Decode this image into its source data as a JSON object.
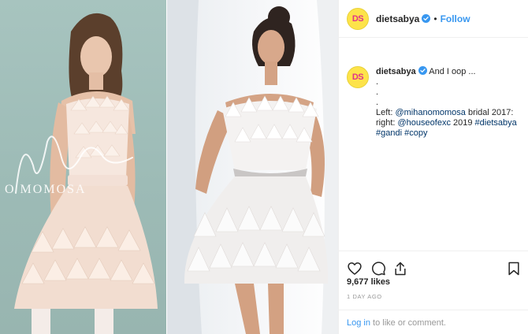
{
  "post": {
    "image_left_watermark": "O MOMOSA",
    "image_left_signature": "Mihano Momosa"
  },
  "header": {
    "avatar_text": "DS",
    "username": "dietsabya",
    "separator": "•",
    "follow_label": "Follow"
  },
  "caption": {
    "avatar_text": "DS",
    "username": "dietsabya",
    "first_line": "And I oop ...",
    "dots": [
      ".",
      ".",
      "."
    ],
    "line1": "Left: ",
    "mention1": "@mihanomomosa",
    "line1_rest": " bridal 2017:",
    "line2": "right: ",
    "mention2": "@houseofexc",
    "line2_mid": " 2019 ",
    "tag1": "#dietsabya",
    "tag2": "#gandi",
    "tag3": "#copy"
  },
  "stats": {
    "likes": "9,677 likes",
    "time_ago": "1 DAY AGO"
  },
  "comment_prompt": {
    "login": "Log in",
    "rest": " to like or comment."
  },
  "colors": {
    "link": "#3897f0",
    "hashtag": "#003569",
    "avatar_bg": "#fde34a",
    "avatar_text": "#e0338a"
  },
  "icons": [
    "heart-icon",
    "comment-icon",
    "share-icon",
    "bookmark-icon",
    "verified-badge-icon"
  ]
}
